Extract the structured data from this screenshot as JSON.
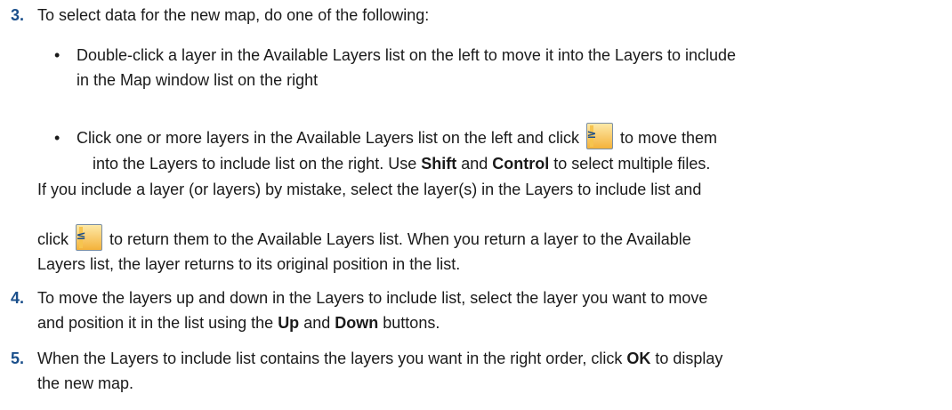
{
  "step3": {
    "number": "3.",
    "text": "To select data for the new map, do one of the following:",
    "bullet1": {
      "line1": "Double-click a layer in the Available Layers list on the left to move it into the Layers to include",
      "line2": "in the Map window list on the right"
    },
    "bullet2": {
      "line1_pre": "Click one or more layers in the Available Layers list on the left and click",
      "line1_post": "to move them",
      "line2_pre": "into the Layers to include list on the right. Use",
      "shift": "Shift",
      "mid": "and",
      "control": "Control",
      "line2_post": "to select multiple files."
    },
    "mistake_line1": "If you include a layer (or layers) by mistake, select the layer(s) in the Layers to include list and",
    "mistake_line2_pre": "click",
    "mistake_line2_post": "to return them to the Available Layers list. When you return a layer to the Available",
    "mistake_line3": "Layers list, the layer returns to its original position in the list."
  },
  "step4": {
    "number": "4.",
    "line1": "To move the layers up and down in the Layers to include list, select the layer you want to move",
    "line2_pre": "and position it in the list using the",
    "up": "Up",
    "mid": "and",
    "down": "Down",
    "line2_post": "buttons."
  },
  "step5": {
    "number": "5.",
    "line1_pre": "When the Layers to include list contains the layers you want in the right order, click",
    "ok": "OK",
    "line1_post": "to display",
    "line2": "the new map."
  },
  "buttons": {
    "add_symbol": "≥",
    "remove_symbol": "≤",
    "accent": "#f4b23a"
  },
  "bullet_char": "•"
}
